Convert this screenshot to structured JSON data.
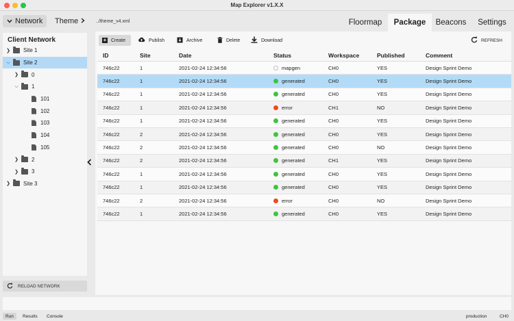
{
  "window": {
    "title": "Map Explorer v1.X.X"
  },
  "topbar": {
    "network_label": "Network",
    "theme_label": "Theme",
    "theme_file": "../theme_v4.xml",
    "tabs": [
      {
        "label": "Floormap"
      },
      {
        "label": "Package"
      },
      {
        "label": "Beacons"
      },
      {
        "label": "Settings"
      }
    ]
  },
  "sidebar": {
    "title": "Client Network",
    "tree": [
      {
        "label": "Site 1"
      },
      {
        "label": "Site 2"
      },
      {
        "label": "0"
      },
      {
        "label": "1"
      },
      {
        "label": "101"
      },
      {
        "label": "102"
      },
      {
        "label": "103"
      },
      {
        "label": "104"
      },
      {
        "label": "105"
      },
      {
        "label": "2"
      },
      {
        "label": "3"
      },
      {
        "label": "Site 3"
      }
    ],
    "reload_label": "RELOAD NETWORK"
  },
  "toolbar": {
    "create": "Create",
    "publish": "Publish",
    "archive": "Archive",
    "delete": "Delete",
    "download": "Download",
    "refresh": "REFRESH"
  },
  "table": {
    "headers": [
      "ID",
      "Site",
      "Date",
      "Status",
      "Workspace",
      "Published",
      "Comment"
    ],
    "status_colors": {
      "generated": "#3ec43e",
      "error": "#f04a1c",
      "mapgen": "#bbbbbb"
    },
    "rows": [
      {
        "id": "746c22",
        "site": "1",
        "date": "2021-02-24 12:34:56",
        "status": "mapgen",
        "workspace": "CH0",
        "published": "YES",
        "comment": "Design Sprint Demo"
      },
      {
        "id": "746c22",
        "site": "1",
        "date": "2021-02-24 12:34:56",
        "status": "generated",
        "workspace": "CH0",
        "published": "YES",
        "comment": "Design Sprint Demo"
      },
      {
        "id": "746c22",
        "site": "1",
        "date": "2021-02-24 12:34:56",
        "status": "generated",
        "workspace": "CH0",
        "published": "YES",
        "comment": "Design Sprint Demo"
      },
      {
        "id": "746c22",
        "site": "1",
        "date": "2021-02-24 12:34:56",
        "status": "error",
        "workspace": "CH1",
        "published": "NO",
        "comment": "Design Sprint Demo"
      },
      {
        "id": "746c22",
        "site": "1",
        "date": "2021-02-24 12:34:56",
        "status": "generated",
        "workspace": "CH0",
        "published": "YES",
        "comment": "Design Sprint Demo"
      },
      {
        "id": "746c22",
        "site": "2",
        "date": "2021-02-24 12:34:56",
        "status": "generated",
        "workspace": "CH0",
        "published": "YES",
        "comment": "Design Sprint Demo"
      },
      {
        "id": "746c22",
        "site": "2",
        "date": "2021-02-24 12:34:56",
        "status": "generated",
        "workspace": "CH0",
        "published": "NO",
        "comment": "Design Sprint Demo"
      },
      {
        "id": "746c22",
        "site": "2",
        "date": "2021-02-24 12:34:56",
        "status": "generated",
        "workspace": "CH1",
        "published": "YES",
        "comment": "Design Sprint Demo"
      },
      {
        "id": "746c22",
        "site": "1",
        "date": "2021-02-24 12:34:56",
        "status": "generated",
        "workspace": "CH0",
        "published": "YES",
        "comment": "Design Sprint Demo"
      },
      {
        "id": "746c22",
        "site": "1",
        "date": "2021-02-24 12:34:56",
        "status": "generated",
        "workspace": "CH0",
        "published": "YES",
        "comment": "Design Sprint Demo"
      },
      {
        "id": "746c22",
        "site": "2",
        "date": "2021-02-24 12:34:56",
        "status": "error",
        "workspace": "CH0",
        "published": "NO",
        "comment": "Design Sprint Demo"
      },
      {
        "id": "746c22",
        "site": "1",
        "date": "2021-02-24 12:34:56",
        "status": "generated",
        "workspace": "CH0",
        "published": "YES",
        "comment": "Design Sprint Demo"
      }
    ]
  },
  "statusbar": {
    "tabs": [
      {
        "label": "Run"
      },
      {
        "label": "Results"
      },
      {
        "label": "Console"
      }
    ],
    "environment": "production",
    "channel": "CH0"
  }
}
